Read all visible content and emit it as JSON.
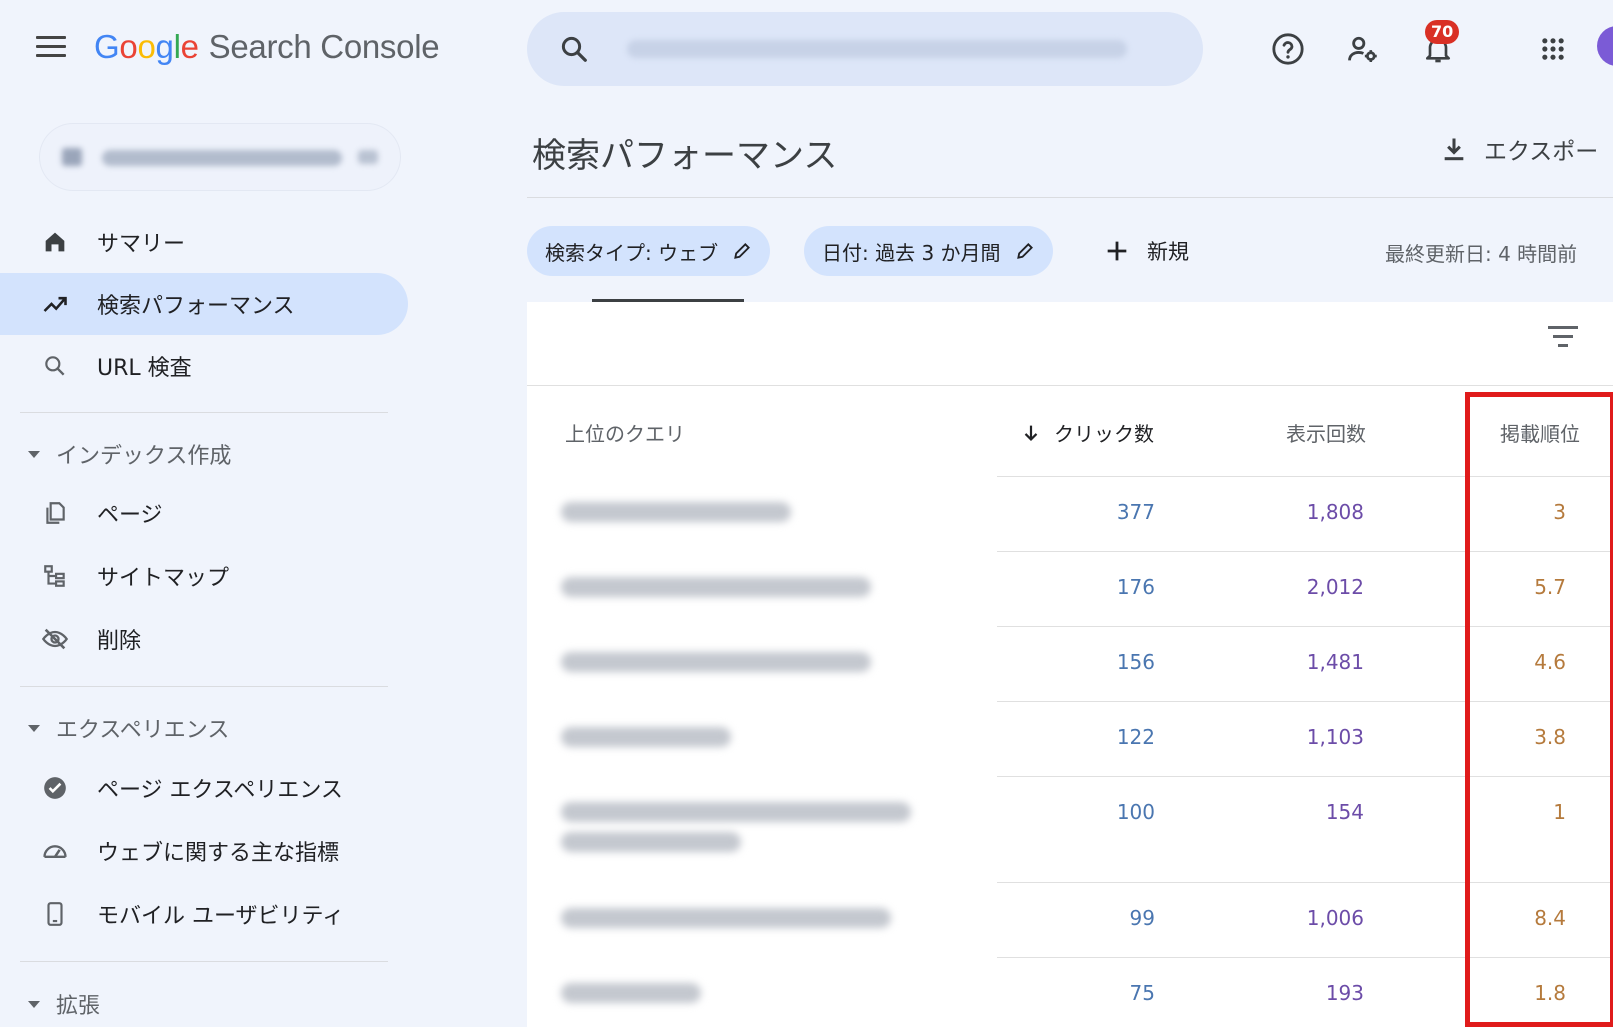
{
  "header": {
    "logo_google": "Google",
    "logo_product": "Search Console",
    "notifications_count": "70"
  },
  "sidebar": {
    "items": [
      {
        "label": "サマリー",
        "icon": "home-icon"
      },
      {
        "label": "検索パフォーマンス",
        "icon": "trending-up-icon",
        "active": true
      },
      {
        "label": "URL 検査",
        "icon": "search-icon"
      }
    ],
    "sections": [
      {
        "label": "インデックス作成",
        "items": [
          {
            "label": "ページ",
            "icon": "pages-icon"
          },
          {
            "label": "サイトマップ",
            "icon": "sitemap-icon"
          },
          {
            "label": "削除",
            "icon": "removal-icon"
          }
        ]
      },
      {
        "label": "エクスペリエンス",
        "items": [
          {
            "label": "ページ エクスペリエンス",
            "icon": "page-experience-icon"
          },
          {
            "label": "ウェブに関する主な指標",
            "icon": "speedometer-icon"
          },
          {
            "label": "モバイル ユーザビリティ",
            "icon": "mobile-icon"
          }
        ]
      },
      {
        "label": "拡張",
        "items": []
      }
    ]
  },
  "main": {
    "title": "検索パフォーマンス",
    "export_label": "エクスポー",
    "chips": [
      {
        "label": "検索タイプ: ウェブ"
      },
      {
        "label": "日付: 過去 3 か月間"
      }
    ],
    "new_label": "新規",
    "last_updated": "最終更新日: 4 時間前",
    "table": {
      "headers": {
        "query": "上位のクエリ",
        "clicks": "クリック数",
        "impressions": "表示回数",
        "position": "掲載順位"
      },
      "rows": [
        {
          "clicks": "377",
          "impressions": "1,808",
          "position": "3"
        },
        {
          "clicks": "176",
          "impressions": "2,012",
          "position": "5.7"
        },
        {
          "clicks": "156",
          "impressions": "1,481",
          "position": "4.6"
        },
        {
          "clicks": "122",
          "impressions": "1,103",
          "position": "3.8"
        },
        {
          "clicks": "100",
          "impressions": "154",
          "position": "1"
        },
        {
          "clicks": "99",
          "impressions": "1,006",
          "position": "8.4"
        },
        {
          "clicks": "75",
          "impressions": "193",
          "position": "1.8"
        }
      ]
    }
  },
  "colors": {
    "accent_active": "#d3e3fd",
    "clicks": "#4a76b0",
    "impressions": "#6c4ca8",
    "position": "#b57a3c",
    "highlight": "#e01b1b"
  }
}
